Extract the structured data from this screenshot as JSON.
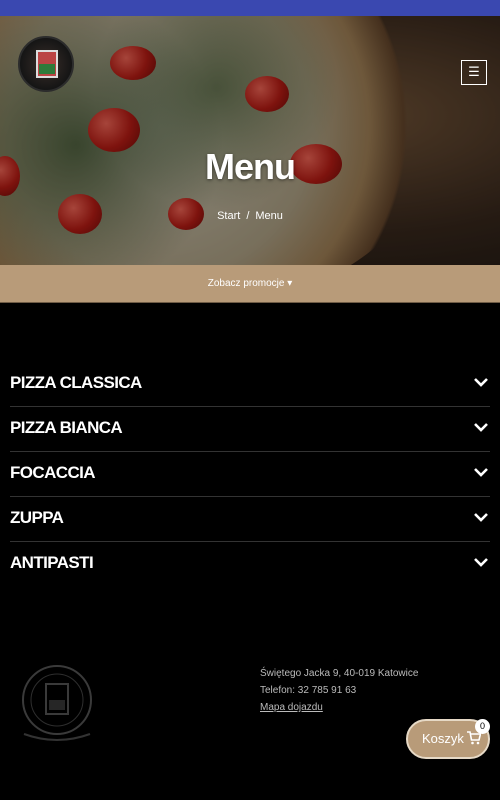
{
  "header": {
    "hero_title": "Menu",
    "breadcrumb": {
      "home": "Start",
      "separator": "/",
      "current": "Menu"
    },
    "menu_icon": "hamburger-icon"
  },
  "promo": {
    "label": "Zobacz promocje ▾"
  },
  "categories": [
    {
      "label": "PIZZA CLASSICA"
    },
    {
      "label": "PIZZA BIANCA"
    },
    {
      "label": "FOCACCIA"
    },
    {
      "label": "ZUPPA"
    },
    {
      "label": "ANTIPASTI"
    }
  ],
  "footer": {
    "address": "Świętego Jacka 9, 40-019 Katowice",
    "phone": "Telefon: 32 785 91 63",
    "map_link": "Mapa dojazdu"
  },
  "cart": {
    "label": "Koszyk",
    "count": "0",
    "icon": "cart-icon"
  },
  "colors": {
    "topbar": "#3a48b0",
    "accent": "#b89b79"
  }
}
